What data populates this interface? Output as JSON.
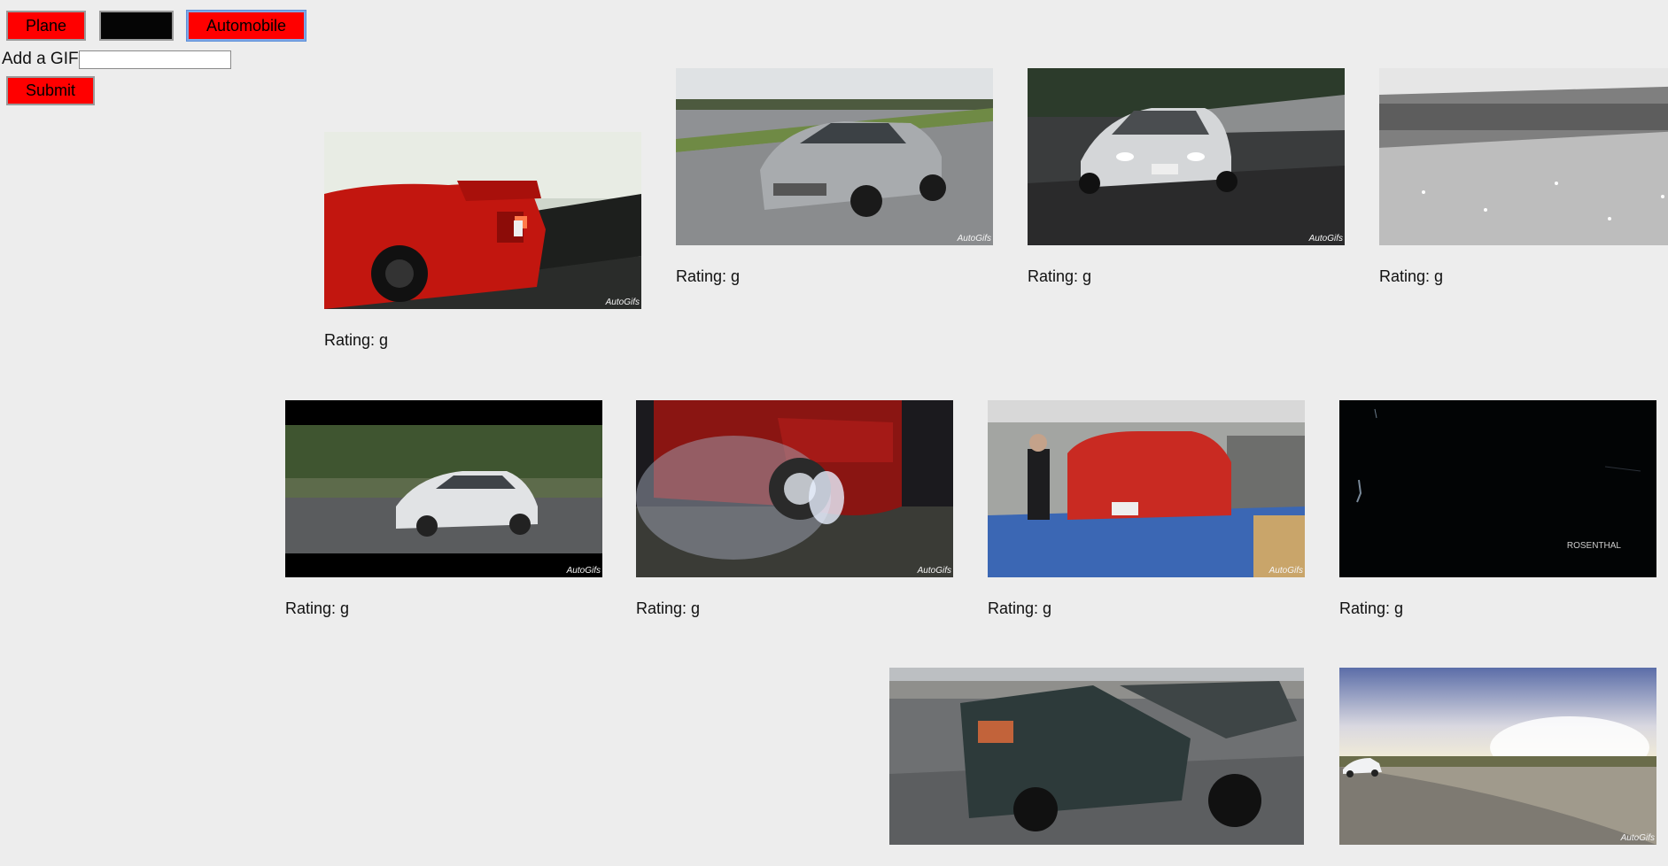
{
  "toolbar": {
    "buttons": [
      {
        "label": "Plane"
      },
      {
        "label": ""
      },
      {
        "label": "Automobile"
      }
    ]
  },
  "form": {
    "add_label": "Add a GIF",
    "input_value": "",
    "submit_label": "Submit"
  },
  "gifs": [
    {
      "subject": "red Ferrari F40 rear on track",
      "rating": "Rating: g",
      "watermark": "AutoGifs"
    },
    {
      "subject": "silver Mercedes sedan on track",
      "rating": "Rating: g",
      "watermark": "AutoGifs"
    },
    {
      "subject": "white Mazda RX-7 on road",
      "rating": "Rating: g",
      "watermark": "AutoGifs"
    },
    {
      "subject": "vintage black and white race crowd",
      "rating": "Rating: g",
      "watermark": ""
    },
    {
      "subject": "white Honda Civic hatchback",
      "rating": "Rating: g",
      "watermark": "AutoGifs"
    },
    {
      "subject": "red car burnout smoke at night",
      "rating": "Rating: g",
      "watermark": "AutoGifs"
    },
    {
      "subject": "red Mitsubishi Lancer on dyno",
      "rating": "Rating: g",
      "watermark": "AutoGifs"
    },
    {
      "subject": "dark frame with light streak",
      "rating": "Rating: g",
      "watermark": "ROSENTHAL"
    },
    {
      "subject": "SUV crash test",
      "rating": "",
      "watermark": ""
    },
    {
      "subject": "white coupe in open lot at sunset",
      "rating": "",
      "watermark": "AutoGifs"
    }
  ],
  "colors": {
    "background": "#ededed",
    "button_red": "#ff0000",
    "button_dark": "#050505",
    "focus_border": "#7fa7e6"
  }
}
